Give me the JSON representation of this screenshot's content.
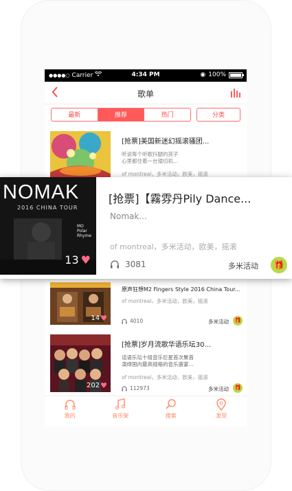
{
  "status_bar": {
    "carrier": "Carrier",
    "time": "4:34 PM",
    "battery": "100%"
  },
  "nav": {
    "title": "歌单",
    "back_icon": "chevron-left-icon",
    "right_icon": "equalizer-icon"
  },
  "tabs": [
    {
      "label": "最新",
      "active": false
    },
    {
      "label": "推荐",
      "active": true
    },
    {
      "label": "热门",
      "active": false
    },
    {
      "label": "分类",
      "active": false
    }
  ],
  "items": [
    {
      "title": "[抢票]美国新迷幻摇滚骚团...",
      "desc": "听说每个听歌抖腿的孩子\n心里都住着一台镭切机...",
      "tags": "of montreal，多米活动，欧美，摇滚",
      "count": "",
      "plays": "",
      "tag": ""
    },
    {
      "title": "原声狂想M2 Fingers Style 2016 China Tour...",
      "desc": "",
      "tags": "of montreal，多米活动，欧美，摇滚",
      "count": "14",
      "plays": "4010",
      "tag": "多米活动"
    },
    {
      "title": "[抢票]岁月流歌华语乐坛30...",
      "desc": "话语乐坛十组音乐巨星首次聚首\n演绎国内最高规格的音乐盛宴...",
      "tags": "of montreal，多米活动，欧美，摇滚",
      "count": "202",
      "plays": "112973",
      "tag": "多米活动"
    }
  ],
  "overlay": {
    "logo": "NOMAK",
    "logo_sub": "2016 CHINA TOUR",
    "mo_text": "MO\nPolar Rhyme",
    "title": "[抢票]【霧雰丹Pily Dance...",
    "author": "Nomak...",
    "tags": "of montreal，多米活动，欧美，摇滚",
    "count": "13",
    "plays": "3081",
    "tag": "多米活动"
  },
  "tabbar": [
    {
      "label": "我的",
      "icon": "headphones-icon"
    },
    {
      "label": "音乐架",
      "icon": "music-note-icon"
    },
    {
      "label": "搜索",
      "icon": "search-icon"
    },
    {
      "label": "发现",
      "icon": "location-pin-icon"
    }
  ],
  "colors": {
    "accent": "#ff5a5a",
    "tabbar": "#ff8a65",
    "gift": "#b7d94a"
  }
}
